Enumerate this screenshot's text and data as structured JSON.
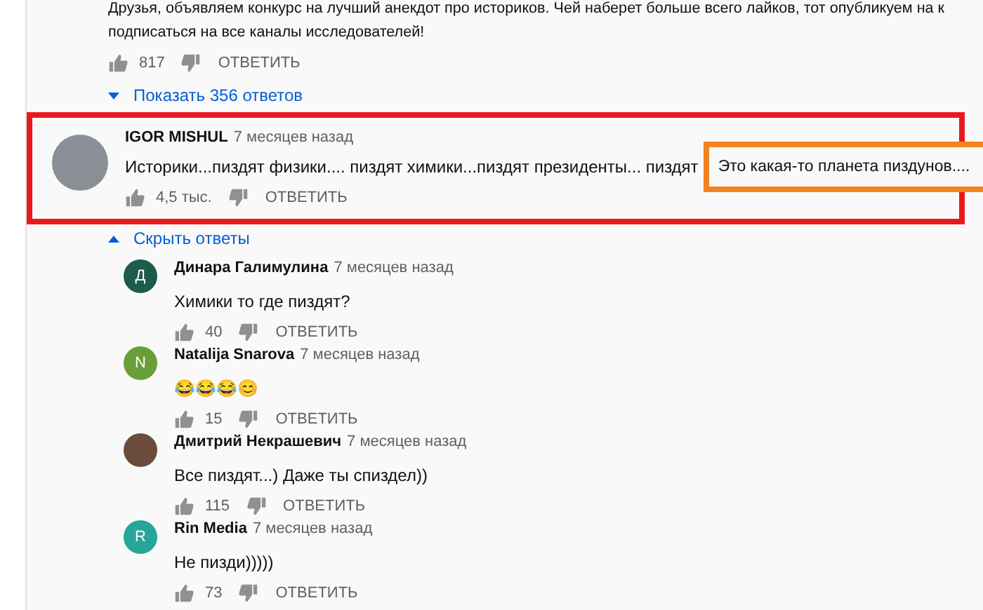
{
  "top_comment": {
    "text_lines": [
      "Друзья, объявляем конкурс на лучший анекдот про историков. Чей наберет больше всего лайков, тот опубликуем на к",
      "подписаться на все каналы исследователей!"
    ],
    "likes": "817",
    "reply": "ОТВЕТИТЬ",
    "toggle": {
      "label": "Показать 356 ответов",
      "expanded": false
    }
  },
  "comment": {
    "highlighted": true,
    "author": "IGOR MISHUL",
    "date": "7 месяцев назад",
    "text": "Историки...пиздят физики.... пиздят химики...пиздят президенты... пиздят",
    "boxed_text": "Это какая-то планета пиздунов....",
    "likes": "4,5 тыс.",
    "reply": "ОТВЕТИТЬ",
    "toggle": {
      "label": "Скрыть ответы",
      "expanded": true
    }
  },
  "replies": [
    {
      "avatar": {
        "kind": "letter",
        "letter": "Д",
        "color": "#1d5b4b"
      },
      "author": "Динара Галимулина",
      "date": "7 месяцев назад",
      "text": "Химики то где пиздят?",
      "likes": "40",
      "reply": "ОТВЕТИТЬ"
    },
    {
      "avatar": {
        "kind": "letter",
        "letter": "N",
        "color": "#689f38"
      },
      "author": "Natalija Snarova",
      "date": "7 месяцев назад",
      "text": "😂😂😂😊",
      "likes": "15",
      "reply": "ОТВЕТИТЬ"
    },
    {
      "avatar": {
        "kind": "photo"
      },
      "author": "Дмитрий Некрашевич",
      "date": "7 месяцев назад",
      "text": "Все пиздят...) Даже ты спиздел))",
      "likes": "115",
      "reply": "ОТВЕТИТЬ"
    },
    {
      "avatar": {
        "kind": "letter",
        "letter": "R",
        "color": "#26a69a"
      },
      "author": "Rin Media",
      "date": "7 месяцев назад",
      "text": "Не пизди)))))",
      "likes": "73",
      "reply": "ОТВЕТИТЬ"
    }
  ]
}
